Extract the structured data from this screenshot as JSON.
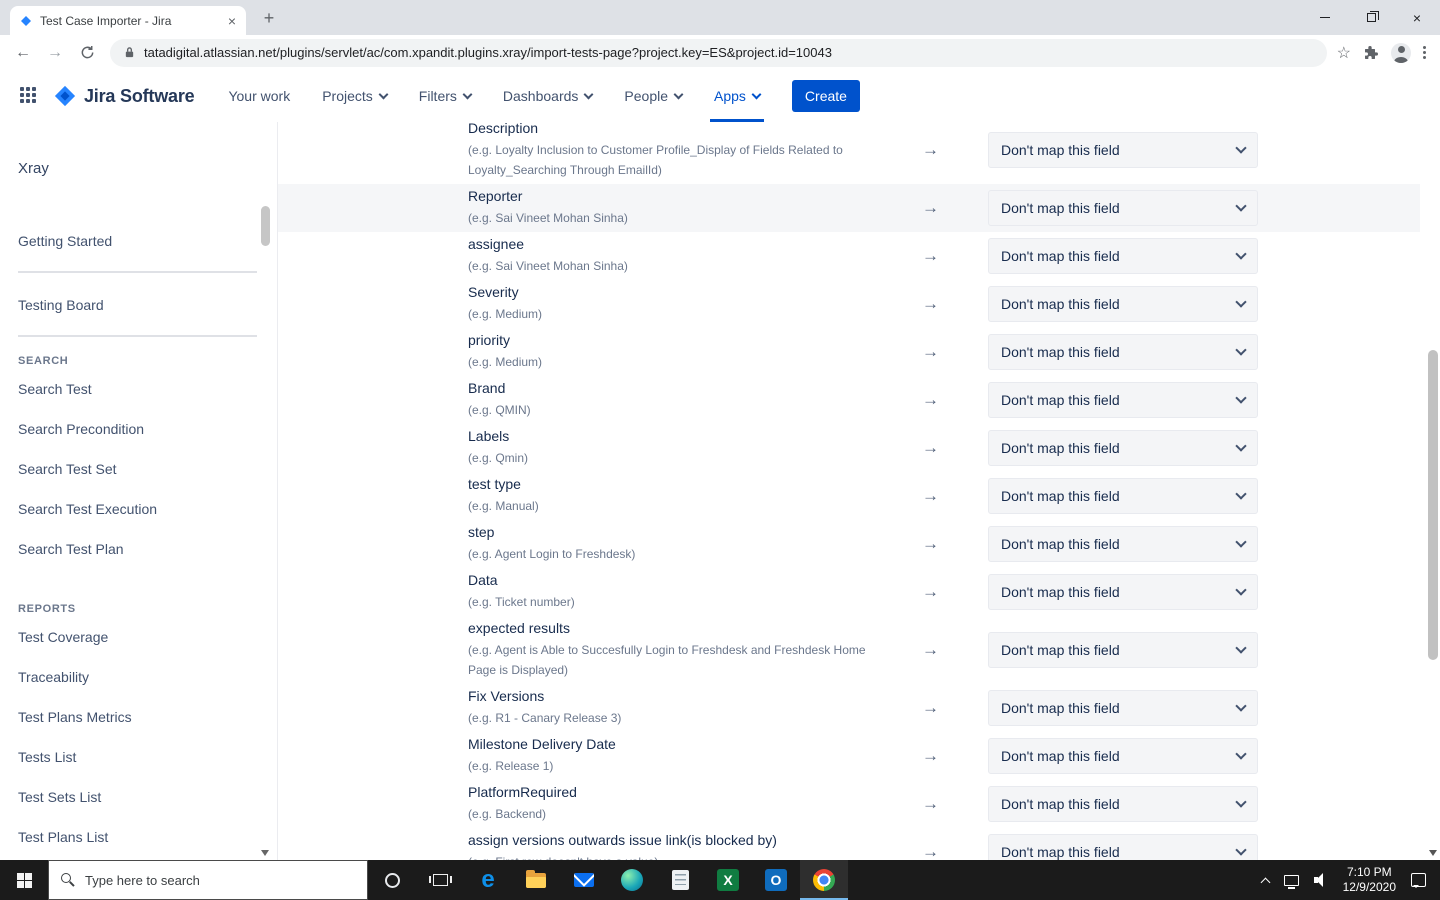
{
  "browser": {
    "tab_title": "Test Case Importer - Jira",
    "url": "tatadigital.atlassian.net/plugins/servlet/ac/com.xpandit.plugins.xray/import-tests-page?project.key=ES&project.id=10043",
    "icons": {
      "back": "←",
      "forward": "→",
      "star": "☆",
      "new_tab": "+",
      "tab_close": "×",
      "window_close": "×"
    }
  },
  "jira": {
    "brand": "Jira Software",
    "nav_items": [
      {
        "label": "Your work",
        "dropdown": false,
        "active": false
      },
      {
        "label": "Projects",
        "dropdown": true,
        "active": false
      },
      {
        "label": "Filters",
        "dropdown": true,
        "active": false
      },
      {
        "label": "Dashboards",
        "dropdown": true,
        "active": false
      },
      {
        "label": "People",
        "dropdown": true,
        "active": false
      },
      {
        "label": "Apps",
        "dropdown": true,
        "active": true
      }
    ],
    "create_label": "Create"
  },
  "sidebar": {
    "title": "Xray",
    "sections": [
      {
        "heading": null,
        "items": [
          "Getting Started"
        ],
        "divider": true,
        "gap": false
      },
      {
        "heading": null,
        "items": [
          "Testing Board"
        ],
        "divider": true,
        "gap": false
      },
      {
        "heading": "SEARCH",
        "items": [
          "Search Test",
          "Search Precondition",
          "Search Test Set",
          "Search Test Execution",
          "Search Test Plan"
        ],
        "divider": false,
        "gap": false
      },
      {
        "heading": "REPORTS",
        "items": [
          "Test Coverage",
          "Traceability",
          "Test Plans Metrics",
          "Tests List",
          "Test Sets List",
          "Test Plans List"
        ],
        "divider": false,
        "gap": true
      }
    ]
  },
  "mapping": {
    "arrow_glyph": "→",
    "dropdown_label": "Don't map this field",
    "rows": [
      {
        "field": "Description",
        "example": "(e.g. Loyalty Inclusion to Customer Profile_Display of Fields Related to Loyalty_Searching Through EmailId)",
        "highlighted": false
      },
      {
        "field": "Reporter",
        "example": "(e.g. Sai Vineet Mohan Sinha)",
        "highlighted": true
      },
      {
        "field": "assignee",
        "example": "(e.g. Sai Vineet Mohan Sinha)",
        "highlighted": false
      },
      {
        "field": "Severity",
        "example": "(e.g. Medium)",
        "highlighted": false
      },
      {
        "field": "priority",
        "example": "(e.g. Medium)",
        "highlighted": false
      },
      {
        "field": "Brand",
        "example": "(e.g. QMIN)",
        "highlighted": false
      },
      {
        "field": "Labels",
        "example": "(e.g. Qmin)",
        "highlighted": false
      },
      {
        "field": "test type",
        "example": "(e.g. Manual)",
        "highlighted": false
      },
      {
        "field": "step",
        "example": "(e.g. Agent Login to Freshdesk)",
        "highlighted": false
      },
      {
        "field": "Data",
        "example": "(e.g. Ticket number)",
        "highlighted": false
      },
      {
        "field": "expected results",
        "example": "(e.g. Agent is Able to Succesfully Login to Freshdesk and Freshdesk Home Page is Displayed)",
        "highlighted": false
      },
      {
        "field": "Fix Versions",
        "example": "(e.g. R1 - Canary Release 3)",
        "highlighted": false
      },
      {
        "field": "Milestone Delivery Date",
        "example": "(e.g. Release 1)",
        "highlighted": false
      },
      {
        "field": "PlatformRequired",
        "example": "(e.g. Backend)",
        "highlighted": false
      },
      {
        "field": "assign versions outwards issue link(is blocked by)",
        "example": "(e.g. First row doesn't have a value)",
        "highlighted": false
      }
    ]
  },
  "taskbar": {
    "search_placeholder": "Type here to search",
    "apps": [
      {
        "name": "edge-icon",
        "icon": "ic-edge",
        "glyph": "e",
        "active": false
      },
      {
        "name": "file-explorer-icon",
        "icon": "ic-folder",
        "glyph": "",
        "active": false
      },
      {
        "name": "mail-icon",
        "icon": "ic-mail",
        "glyph": "",
        "active": false
      },
      {
        "name": "globe-icon",
        "icon": "ic-globe",
        "glyph": "",
        "active": false
      },
      {
        "name": "notepad-icon",
        "icon": "ic-notes",
        "glyph": "",
        "active": false
      },
      {
        "name": "excel-icon",
        "icon": "ic-excel",
        "glyph": "X",
        "active": false
      },
      {
        "name": "outlook-icon",
        "icon": "ic-outlook",
        "glyph": "O",
        "active": false
      },
      {
        "name": "chrome-icon",
        "icon": "ic-chrome",
        "glyph": "",
        "active": true
      }
    ],
    "clock": {
      "time": "7:10 PM",
      "date": "12/9/2020"
    }
  }
}
